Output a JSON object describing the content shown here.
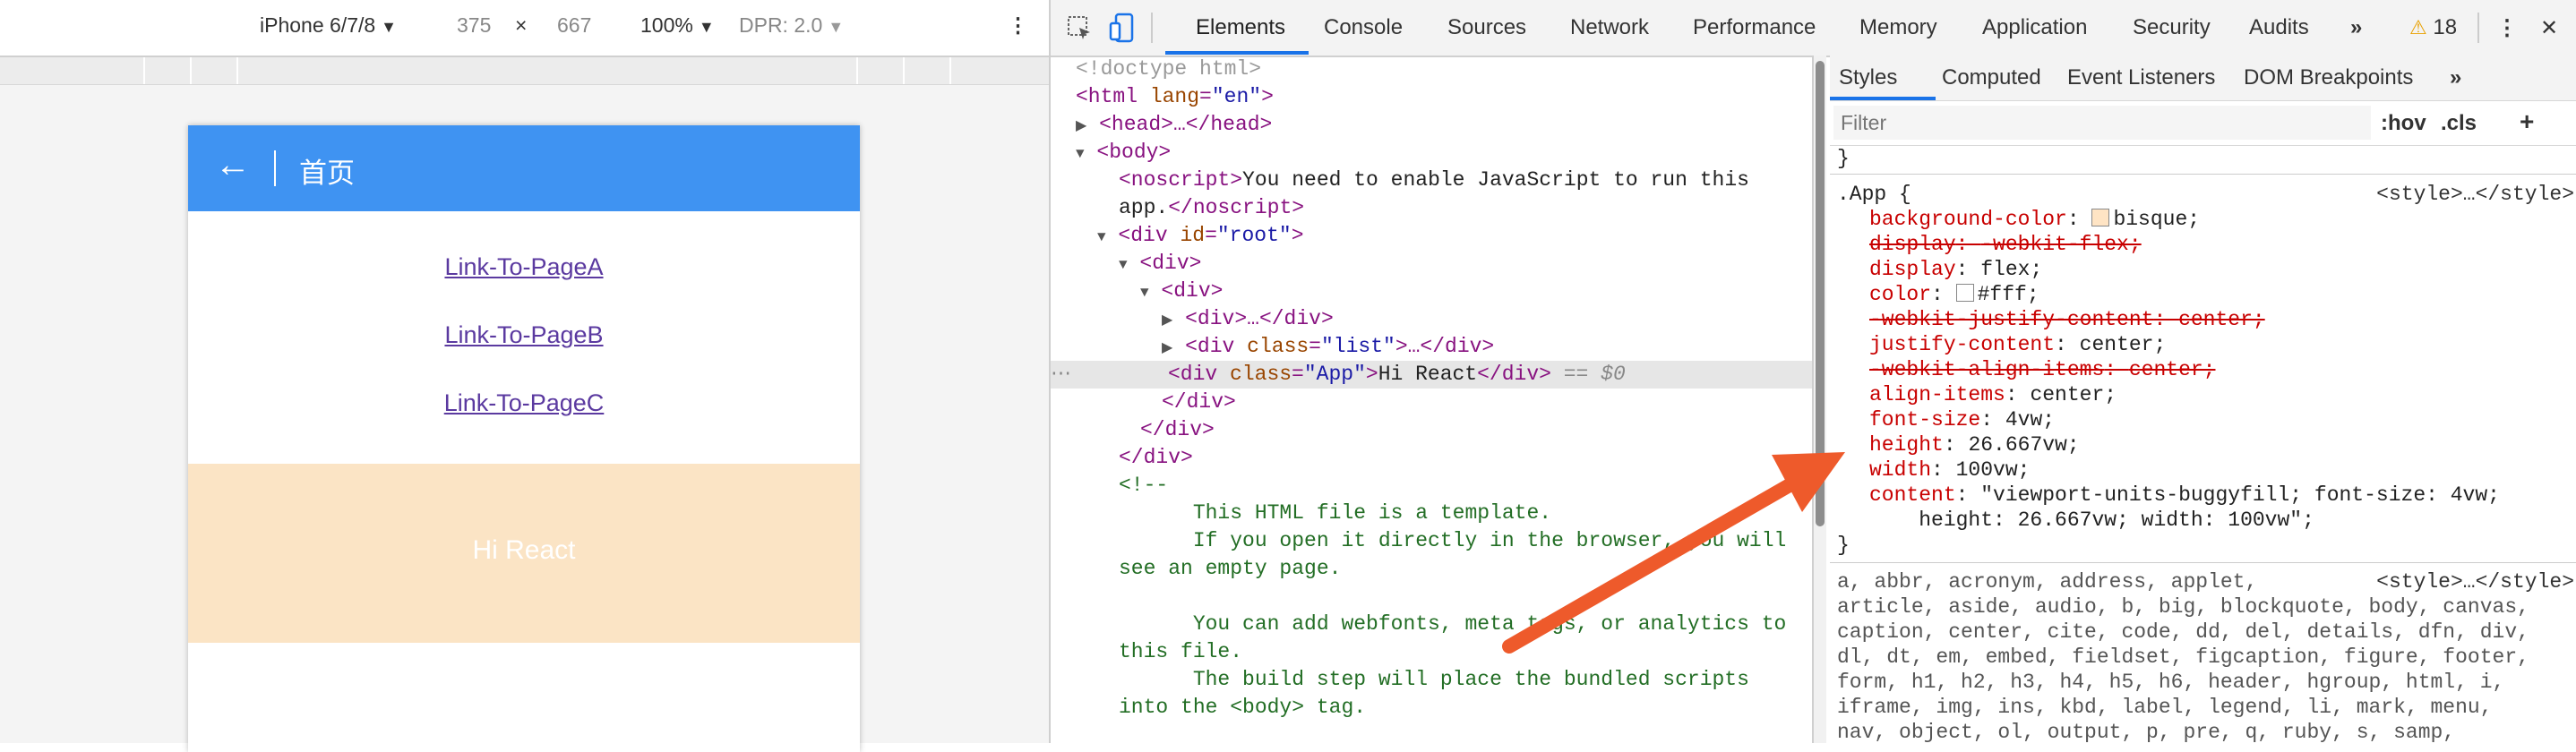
{
  "device_toolbar": {
    "device": "iPhone 6/7/8",
    "width": "375",
    "times": "×",
    "height": "667",
    "zoom": "100%",
    "dpr": "DPR: 2.0",
    "more": "⋮"
  },
  "phone": {
    "header_title": "首页",
    "back": "←",
    "links": [
      "Link-To-PageA",
      "Link-To-PageB",
      "Link-To-PageC"
    ],
    "app_text": "Hi React"
  },
  "devtools": {
    "tabs": [
      "Elements",
      "Console",
      "Sources",
      "Network",
      "Performance",
      "Memory",
      "Application",
      "Security",
      "Audits"
    ],
    "overflow": "»",
    "warnings": "18",
    "warning_icon": "⚠",
    "menu": "⋮",
    "close": "✕"
  },
  "dom": {
    "doctype": "<!doctype html>",
    "html_open": "<html",
    "lang_attr": "lang",
    "lang_val": "\"en\"",
    "head": "<head>…</head>",
    "body": "<body>",
    "noscript_open": "<noscript>",
    "noscript_text": "You need to enable JavaScript to run this",
    "noscript_text2": "app.",
    "noscript_close": "</noscript>",
    "div_root_open": "<div",
    "id_attr": "id",
    "root_val": "\"root\"",
    "div_open": "<div>",
    "div_collapsed": "<div>…</div>",
    "class_attr": "class",
    "list_val": "\"list\"",
    "list_tail": ">…</div>",
    "app_val": "\"App\"",
    "app_text": "Hi React",
    "div_close": "</div>",
    "selected_marker": "== $0",
    "comment_open": "<!--",
    "comment_lines": [
      "      This HTML file is a template.",
      "      If you open it directly in the browser, you will",
      "see an empty page.",
      "",
      "      You can add webfonts, meta tags, or analytics to",
      "this file.",
      "      The build step will place the bundled scripts",
      "into the <body> tag."
    ]
  },
  "styles": {
    "sub_tabs": [
      "Styles",
      "Computed",
      "Event Listeners",
      "DOM Breakpoints"
    ],
    "sub_overflow": "»",
    "filter_placeholder": "Filter",
    "hov": ":hov",
    "cls": ".cls",
    "plus": "+",
    "closing_brace": "}",
    "rule1": {
      "selector": ".App {",
      "source": "<style>…</style>",
      "props": [
        {
          "name": "background-color",
          "value": "bisque;",
          "swatch": "#ffe4c4",
          "struck": false
        },
        {
          "name": "display",
          "value": "-webkit-flex;",
          "struck": true
        },
        {
          "name": "display",
          "value": "flex;",
          "struck": false
        },
        {
          "name": "color",
          "value": "#fff;",
          "swatch": "#ffffff",
          "struck": false
        },
        {
          "name": "-webkit-justify-content",
          "value": "center;",
          "struck": true
        },
        {
          "name": "justify-content",
          "value": "center;",
          "struck": false
        },
        {
          "name": "-webkit-align-items",
          "value": "center;",
          "struck": true
        },
        {
          "name": "align-items",
          "value": "center;",
          "struck": false
        },
        {
          "name": "font-size",
          "value": "4vw;",
          "struck": false
        },
        {
          "name": "height",
          "value": "26.667vw;",
          "struck": false
        },
        {
          "name": "width",
          "value": "100vw;",
          "struck": false
        },
        {
          "name": "content",
          "value": "\"viewport-units-buggyfill; font-size: 4vw;",
          "struck": false
        }
      ],
      "content_cont": "    height: 26.667vw; width: 100vw\";",
      "close": "}"
    },
    "rule2": {
      "source": "<style>…</style>",
      "lines": [
        "a, abbr, acronym, address, applet,",
        "article, aside, audio, b, big, blockquote, body, canvas,",
        "caption, center, cite, code, dd, del, details, dfn, div,",
        "dl, dt, em, embed, fieldset, figcaption, figure, footer,",
        "form, h1, h2, h3, h4, h5, h6, header, hgroup, html, i,",
        "iframe, img, ins, kbd, label, legend, li, mark, menu,",
        "nav, object, ol, output, p, pre, q, ruby, s, samp,"
      ]
    }
  },
  "colors": {
    "header_blue": "#3f93f2",
    "bisque": "#fbe4c5",
    "arrow": "#ee5a2b",
    "accent": "#1a73e8"
  }
}
